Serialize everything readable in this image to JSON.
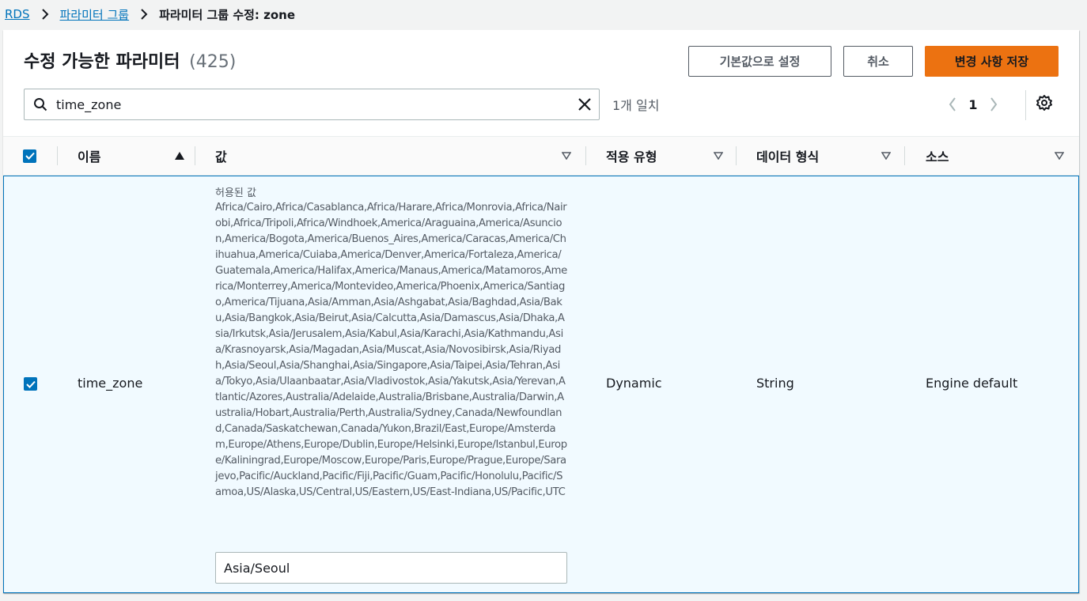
{
  "breadcrumb": {
    "items": [
      "RDS",
      "파라미터 그룹"
    ],
    "current": "파라미터 그룹 수정: zone"
  },
  "header": {
    "title": "수정 가능한 파라미터",
    "count": "(425)"
  },
  "buttons": {
    "defaults": "기본값으로 설정",
    "cancel": "취소",
    "save": "변경 사항 저장"
  },
  "search": {
    "value": "time_zone",
    "matches": "1개 일치"
  },
  "pagination": {
    "current_page": "1"
  },
  "table": {
    "columns": [
      "이름",
      "값",
      "적용 유형",
      "데이터 형식",
      "소스"
    ],
    "rows": [
      {
        "selected": true,
        "name": "time_zone",
        "allowed_label": "허용된 값",
        "allowed_values": "Africa/Cairo,Africa/Casablanca,Africa/Harare,Africa/Monrovia,Africa/Nairobi,Africa/Tripoli,Africa/Windhoek,America/Araguaina,America/Asuncion,America/Bogota,America/Buenos_Aires,America/Caracas,America/Chihuahua,America/Cuiaba,America/Denver,America/Fortaleza,America/Guatemala,America/Halifax,America/Manaus,America/Matamoros,America/Monterrey,America/Montevideo,America/Phoenix,America/Santiago,America/Tijuana,Asia/Amman,Asia/Ashgabat,Asia/Baghdad,Asia/Baku,Asia/Bangkok,Asia/Beirut,Asia/Calcutta,Asia/Damascus,Asia/Dhaka,Asia/Irkutsk,Asia/Jerusalem,Asia/Kabul,Asia/Karachi,Asia/Kathmandu,Asia/Krasnoyarsk,Asia/Magadan,Asia/Muscat,Asia/Novosibirsk,Asia/Riyadh,Asia/Seoul,Asia/Shanghai,Asia/Singapore,Asia/Taipei,Asia/Tehran,Asia/Tokyo,Asia/Ulaanbaatar,Asia/Vladivostok,Asia/Yakutsk,Asia/Yerevan,Atlantic/Azores,Australia/Adelaide,Australia/Brisbane,Australia/Darwin,Australia/Hobart,Australia/Perth,Australia/Sydney,Canada/Newfoundland,Canada/Saskatchewan,Canada/Yukon,Brazil/East,Europe/Amsterdam,Europe/Athens,Europe/Dublin,Europe/Helsinki,Europe/Istanbul,Europe/Kaliningrad,Europe/Moscow,Europe/Paris,Europe/Prague,Europe/Sarajevo,Pacific/Auckland,Pacific/Fiji,Pacific/Guam,Pacific/Honolulu,Pacific/Samoa,US/Alaska,US/Central,US/Eastern,US/East-Indiana,US/Pacific,UTC",
        "value": "Asia/Seoul",
        "apply_type": "Dynamic",
        "data_type": "String",
        "source": "Engine default"
      }
    ]
  },
  "colors": {
    "link": "#0073bb",
    "primary": "#ec7211",
    "selected_row_bg": "#f1faff",
    "selected_border": "#0073bb"
  },
  "icons": [
    "chevron-right-icon",
    "search-icon",
    "close-icon",
    "chevron-left-icon",
    "gear-icon",
    "sort-asc-icon",
    "sort-down-icon",
    "check-icon"
  ]
}
